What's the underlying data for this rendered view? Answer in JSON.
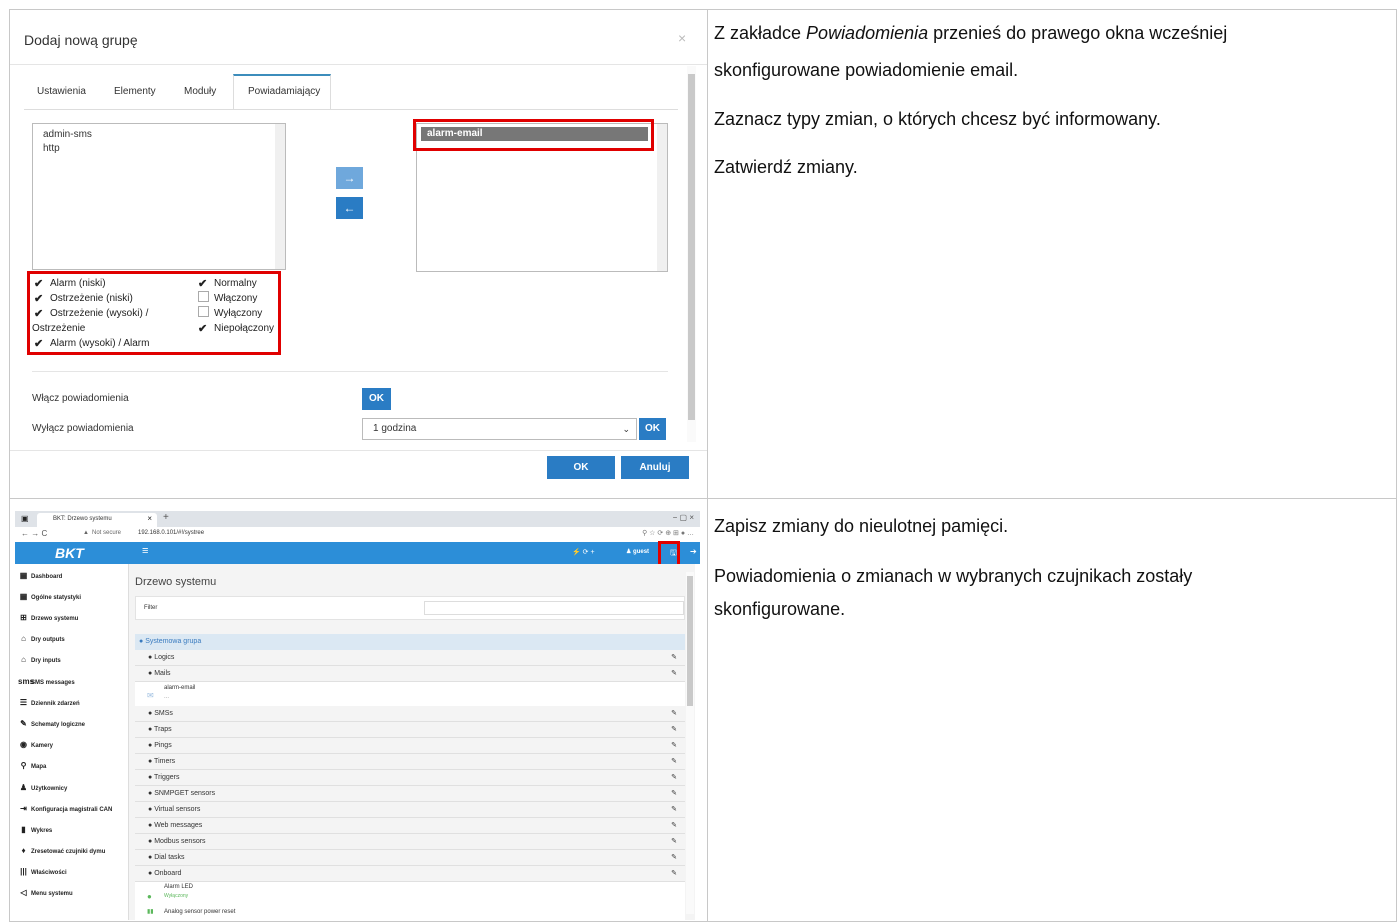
{
  "modal": {
    "title": "Dodaj nową grupę",
    "close": "×",
    "tabs": [
      "Ustawienia",
      "Elementy",
      "Moduły",
      "Powiadamiający"
    ],
    "available_list": [
      "admin-sms",
      "http"
    ],
    "selected_list": [
      "alarm-email"
    ],
    "move_right": "→",
    "move_left": "←",
    "checkboxes_left": [
      {
        "label": "Alarm (niski)",
        "checked": true
      },
      {
        "label": "Ostrzeżenie (niski)",
        "checked": true
      },
      {
        "label": "Ostrzeżenie (wysoki) /",
        "checked": true
      },
      {
        "label": "Ostrzeżenie",
        "checked": false
      },
      {
        "label": "Alarm (wysoki) / Alarm",
        "checked": true
      }
    ],
    "checkboxes_right": [
      {
        "label": "Normalny",
        "checked": true
      },
      {
        "label": "Włączony",
        "checked": false
      },
      {
        "label": "Wyłączony",
        "checked": false
      },
      {
        "label": "Niepołączony",
        "checked": true
      }
    ],
    "enable_label": "Włącz powiadomienia",
    "disable_label": "Wyłącz powiadomienia",
    "ok": "OK",
    "duration": "1 godzina",
    "footer_ok": "OK",
    "cancel": "Anuluj"
  },
  "instructions_top": {
    "p1_pre": "Z zakładce ",
    "p1_em": "Powiadomienia",
    "p1_post": " przenieś do prawego okna wcześniej",
    "p1_line2": "skonfigurowane powiadomienie email.",
    "p2": "Zaznacz typy zmian, o których chcesz być informowany.",
    "p3": "Zatwierdź zmiany."
  },
  "instructions_bottom": {
    "p1": "Zapisz zmiany do nieulotnej pamięci.",
    "p2_line1": "Powiadomienia o zmianach w wybranych czujnikach zostały",
    "p2_line2": "skonfigurowane."
  },
  "browser": {
    "tab_title": "BKT: Drzewo systemu",
    "tab_close": "×",
    "new_tab": "+",
    "not_secure": "Not secure",
    "url": "192.168.0.101/#!/systree",
    "window_controls": "−   ▢   ×",
    "logo": "BKT",
    "menu": "≡",
    "user": "guest"
  },
  "sidebar": [
    {
      "icon": "▦",
      "label": "Dashboard"
    },
    {
      "icon": "▦",
      "label": "Ogólne statystyki"
    },
    {
      "icon": "⊞",
      "label": "Drzewo systemu"
    },
    {
      "icon": "⌂",
      "label": "Dry outputs"
    },
    {
      "icon": "⌂",
      "label": "Dry inputs"
    },
    {
      "icon": "sms",
      "label": "SMS messages"
    },
    {
      "icon": "☰",
      "label": "Dziennik zdarzeń"
    },
    {
      "icon": "✎",
      "label": "Schematy logiczne"
    },
    {
      "icon": "◉",
      "label": "Kamery"
    },
    {
      "icon": "⚲",
      "label": "Mapa"
    },
    {
      "icon": "♟",
      "label": "Użytkownicy"
    },
    {
      "icon": "⇥",
      "label": "Konfiguracja magistrali CAN"
    },
    {
      "icon": "▮",
      "label": "Wykres"
    },
    {
      "icon": "♦",
      "label": "Zresetować czujniki dymu"
    },
    {
      "icon": "|||",
      "label": "Właściwości"
    },
    {
      "icon": "◁",
      "label": "Menu systemu"
    }
  ],
  "tree": {
    "title": "Drzewo systemu",
    "filter_label": "Filter",
    "group": "Systemowa grupa",
    "rows": [
      "Logics",
      "Mails",
      "SMSs",
      "Traps",
      "Pings",
      "Timers",
      "Triggers",
      "SNMPGET sensors",
      "Virtual sensors",
      "Web messages",
      "Modbus sensors",
      "Dial tasks",
      "Onboard"
    ],
    "mail_item": "alarm-email",
    "mail_item_sub": "...",
    "onboard_item": "Alarm LED",
    "onboard_status": "Wyłączony",
    "onboard_item2": "Analog sensor power reset"
  },
  "colors": {
    "accent": "#2a7cc4",
    "highlight": "#e00000",
    "appbar": "#2c8ed8"
  }
}
